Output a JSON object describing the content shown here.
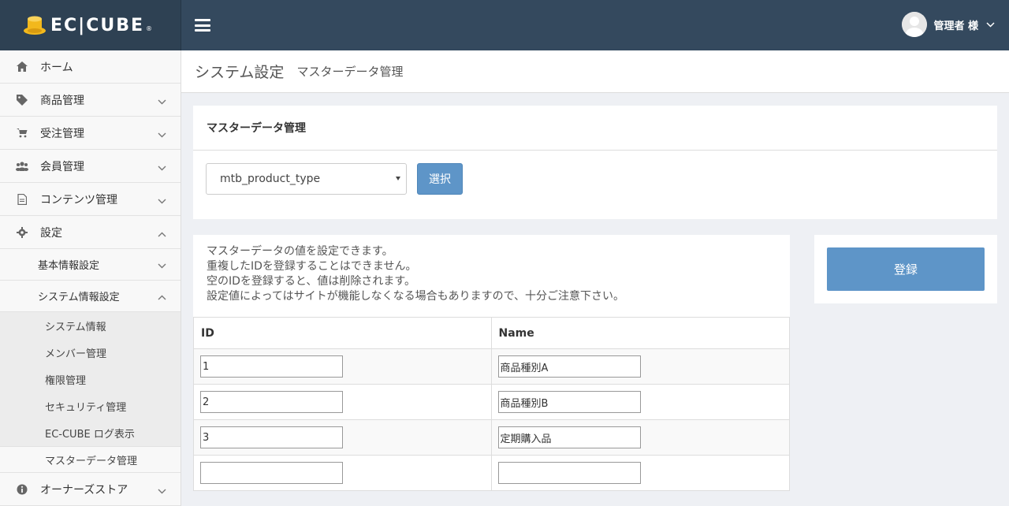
{
  "header": {
    "logo_text": "EC|CUBE",
    "logo_reg": "®",
    "user_name": "管理者 様"
  },
  "sidebar": {
    "items": [
      {
        "label": "ホーム",
        "icon": "home-icon"
      },
      {
        "label": "商品管理",
        "icon": "tag-icon"
      },
      {
        "label": "受注管理",
        "icon": "cart-icon"
      },
      {
        "label": "会員管理",
        "icon": "users-icon"
      },
      {
        "label": "コンテンツ管理",
        "icon": "file-icon"
      },
      {
        "label": "設定",
        "icon": "gear-icon"
      }
    ],
    "settings_sub": [
      {
        "label": "基本情報設定"
      },
      {
        "label": "システム情報設定"
      }
    ],
    "system_sub": [
      {
        "label": "システム情報"
      },
      {
        "label": "メンバー管理"
      },
      {
        "label": "権限管理"
      },
      {
        "label": "セキュリティ管理"
      },
      {
        "label": "EC-CUBE ログ表示"
      },
      {
        "label": "マスターデータ管理"
      }
    ],
    "owner_store": {
      "label": "オーナーズストア",
      "icon": "info-icon"
    }
  },
  "page": {
    "title": "システム設定",
    "subtitle": "マスターデータ管理"
  },
  "master_card": {
    "heading": "マスターデータ管理",
    "select_value": "mtb_product_type",
    "select_button": "選択"
  },
  "description": {
    "lines": [
      "マスターデータの値を設定できます。",
      "重複したIDを登録することはできません。",
      "空のIDを登録すると、値は削除されます。",
      "設定値によってはサイトが機能しなくなる場合もありますので、十分ご注意下さい。"
    ]
  },
  "table": {
    "headers": [
      "ID",
      "Name"
    ],
    "rows": [
      {
        "id": "1",
        "name": "商品種別A"
      },
      {
        "id": "2",
        "name": "商品種別B"
      },
      {
        "id": "3",
        "name": "定期購入品"
      },
      {
        "id": "",
        "name": ""
      }
    ]
  },
  "actions": {
    "register_label": "登録"
  },
  "colors": {
    "header_bg": "#34495e",
    "accent": "#5e95c8",
    "logo_gold": "#f2b81c"
  }
}
